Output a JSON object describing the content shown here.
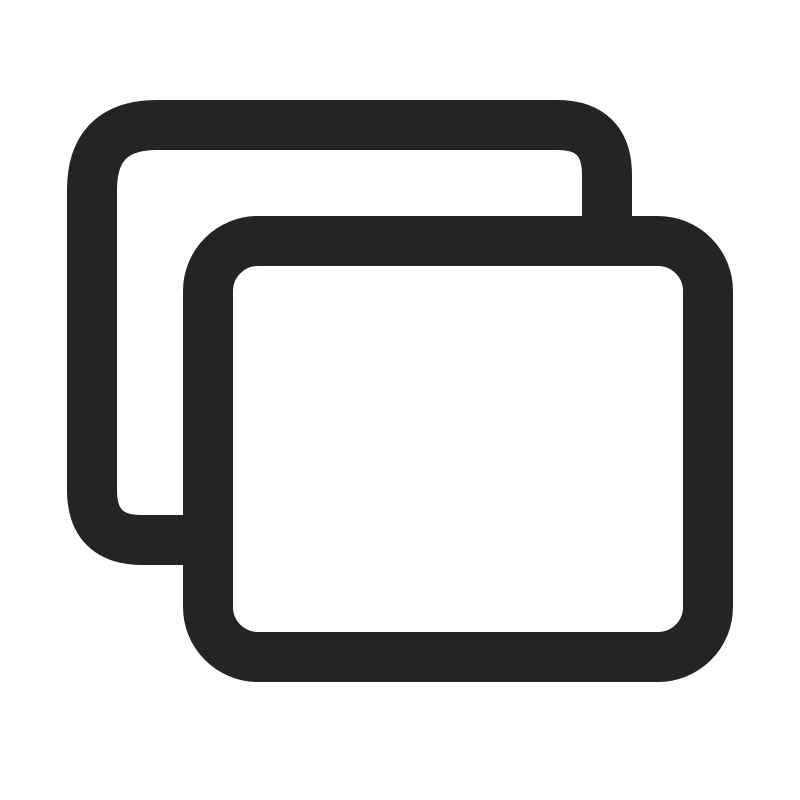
{
  "icon": {
    "name": "windows-stack-icon",
    "stroke_color": "#242424",
    "background_color": "#ffffff"
  }
}
